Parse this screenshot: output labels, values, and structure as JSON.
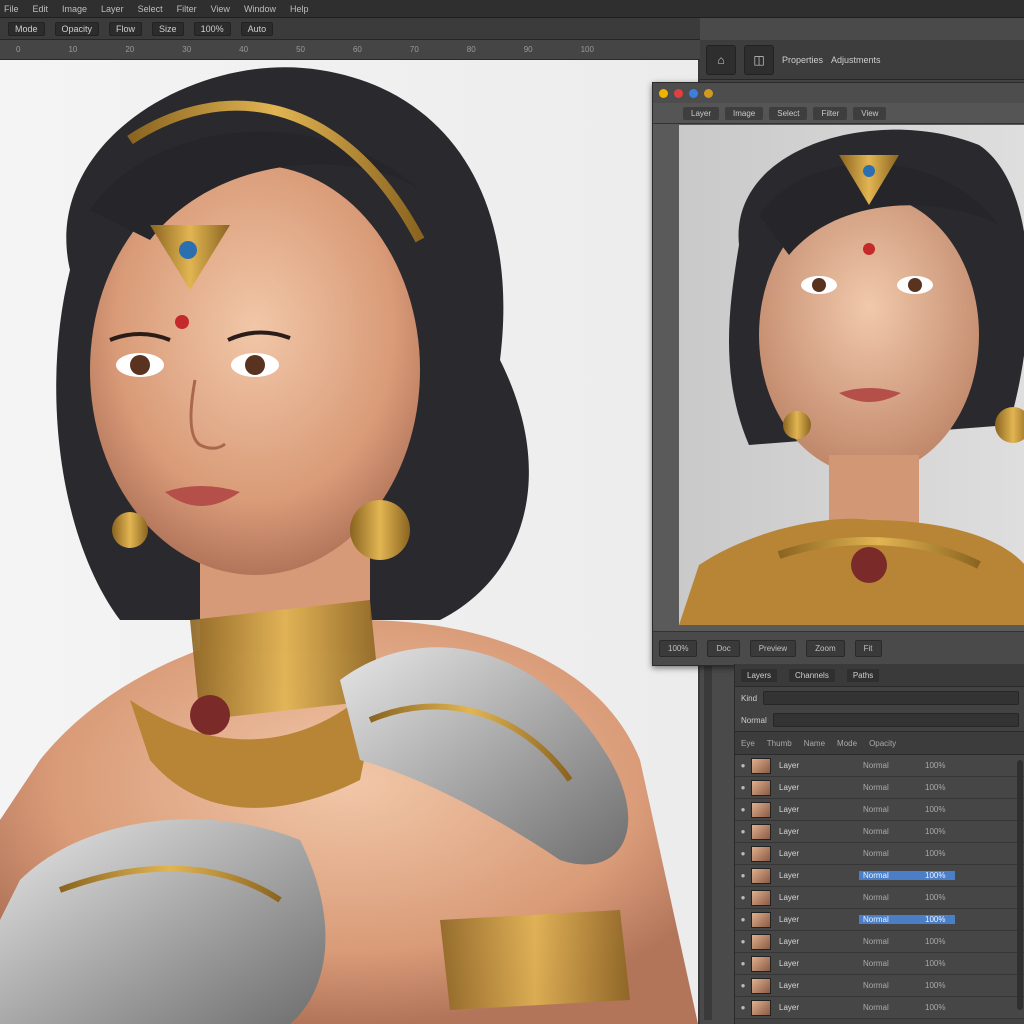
{
  "menubar": {
    "items": [
      "File",
      "Edit",
      "Image",
      "Layer",
      "Select",
      "Filter",
      "View",
      "Window",
      "Help"
    ]
  },
  "options_bar": {
    "items": [
      "Mode",
      "Opacity",
      "Flow",
      "Size",
      "100%",
      "Auto"
    ]
  },
  "ruler": {
    "ticks": [
      "0",
      "10",
      "20",
      "30",
      "40",
      "50",
      "60",
      "70",
      "80",
      "90",
      "100"
    ]
  },
  "top_panel": {
    "tab_label": "Properties",
    "subtitle": "Adjustments"
  },
  "preview_window": {
    "dots": [
      "#f0b400",
      "#e04040",
      "#3d7ee0",
      "#d09a20"
    ],
    "tabs": [
      "Layer",
      "Image",
      "Select",
      "Filter",
      "View"
    ],
    "footer": [
      "100%",
      "Doc",
      "Preview",
      "Zoom",
      "Fit"
    ]
  },
  "layers_panel": {
    "tabs": [
      "Layers",
      "Channels",
      "Paths"
    ],
    "filter_label": "Kind",
    "blend_label": "Normal",
    "columns": [
      "Eye",
      "Thumb",
      "Name",
      "Mode",
      "Opacity"
    ],
    "rows": [
      {
        "name": "Layer",
        "mode": "Normal",
        "opacity": "100%",
        "selected": false
      },
      {
        "name": "Layer",
        "mode": "Normal",
        "opacity": "100%",
        "selected": false
      },
      {
        "name": "Layer",
        "mode": "Normal",
        "opacity": "100%",
        "selected": false
      },
      {
        "name": "Layer",
        "mode": "Normal",
        "opacity": "100%",
        "selected": false
      },
      {
        "name": "Layer",
        "mode": "Normal",
        "opacity": "100%",
        "selected": false
      },
      {
        "name": "Layer",
        "mode": "Normal",
        "opacity": "100%",
        "selected": true
      },
      {
        "name": "Layer",
        "mode": "Normal",
        "opacity": "100%",
        "selected": false
      },
      {
        "name": "Layer",
        "mode": "Normal",
        "opacity": "100%",
        "selected": true
      },
      {
        "name": "Layer",
        "mode": "Normal",
        "opacity": "100%",
        "selected": false
      },
      {
        "name": "Layer",
        "mode": "Normal",
        "opacity": "100%",
        "selected": false
      },
      {
        "name": "Layer",
        "mode": "Normal",
        "opacity": "100%",
        "selected": false
      },
      {
        "name": "Layer",
        "mode": "Normal",
        "opacity": "100%",
        "selected": false
      }
    ]
  }
}
